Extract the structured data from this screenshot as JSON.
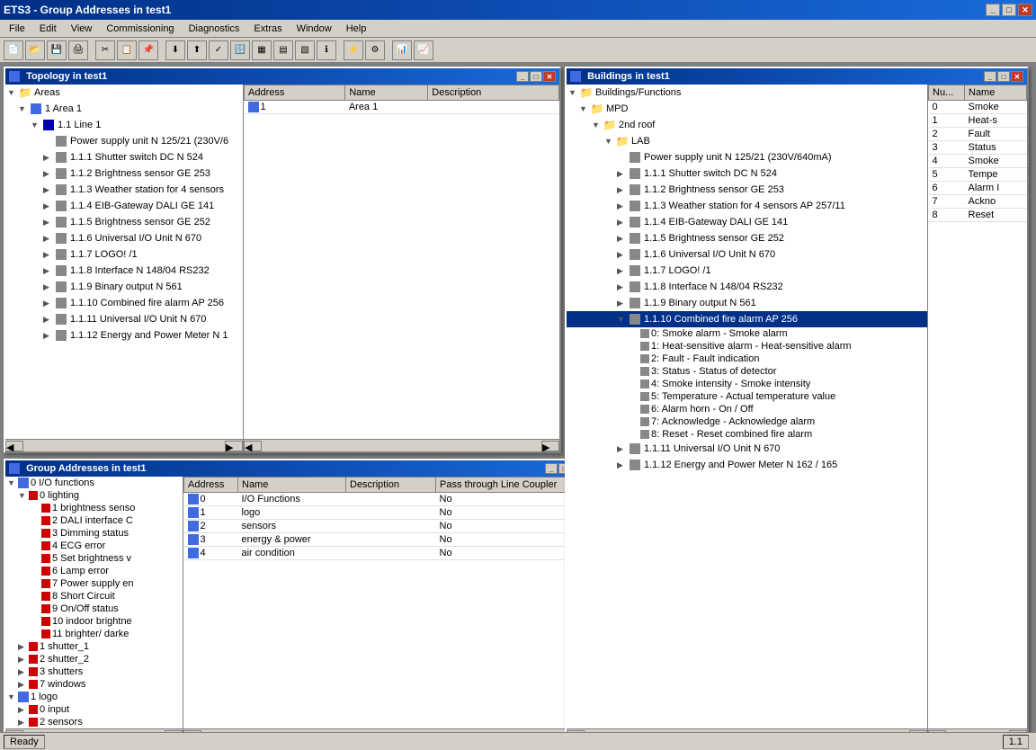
{
  "app": {
    "title": "ETS3 - Group Addresses in test1",
    "status": "Ready",
    "version": "1.1"
  },
  "menu": {
    "items": [
      "File",
      "Edit",
      "View",
      "Commissioning",
      "Diagnostics",
      "Extras",
      "Window",
      "Help"
    ]
  },
  "topology_window": {
    "title": "Topology in test1",
    "columns": [
      "Address",
      "Name",
      "Description"
    ],
    "area_row": {
      "address": "1",
      "name": "Area 1"
    },
    "tree": [
      {
        "label": "Areas",
        "level": 0,
        "expanded": true
      },
      {
        "label": "1 Area 1",
        "level": 1,
        "expanded": true
      },
      {
        "label": "1.1 Line 1",
        "level": 2,
        "expanded": true
      },
      {
        "label": "Power supply unit N 125/21 (230V/6",
        "level": 3
      },
      {
        "label": "1.1.1 Shutter switch DC N 524",
        "level": 3
      },
      {
        "label": "1.1.2 Brightness sensor GE 253",
        "level": 3
      },
      {
        "label": "1.1.3 Weather station for 4 sensors",
        "level": 3
      },
      {
        "label": "1.1.4 EIB-Gateway DALI GE 141",
        "level": 3
      },
      {
        "label": "1.1.5 Brightness sensor GE 252",
        "level": 3
      },
      {
        "label": "1.1.6 Universal I/O Unit N 670",
        "level": 3
      },
      {
        "label": "1.1.7 LOGO!  /1",
        "level": 3
      },
      {
        "label": "1.1.8 Interface N 148/04 RS232",
        "level": 3
      },
      {
        "label": "1.1.9 Binary output N 561",
        "level": 3
      },
      {
        "label": "1.1.10 Combined fire alarm AP 256",
        "level": 3
      },
      {
        "label": "1.1.11 Universal I/O Unit N 670",
        "level": 3
      },
      {
        "label": "1.1.12 Energy and Power Meter N 1",
        "level": 3
      }
    ]
  },
  "group_addresses_window": {
    "title": "Group Addresses in test1",
    "columns": [
      "Address",
      "Name",
      "Description",
      "Pass through Line Coupler"
    ],
    "tree": [
      {
        "label": "0 I/O functions",
        "level": 0,
        "expanded": true
      },
      {
        "label": "0 lighting",
        "level": 1,
        "expanded": true
      },
      {
        "label": "1 brightness senso",
        "level": 2
      },
      {
        "label": "2 DALI interface C",
        "level": 2
      },
      {
        "label": "3 Dimming status",
        "level": 2
      },
      {
        "label": "4 ECG error",
        "level": 2
      },
      {
        "label": "5 Set brightness v",
        "level": 2
      },
      {
        "label": "6 Lamp error",
        "level": 2
      },
      {
        "label": "7 Power supply en",
        "level": 2
      },
      {
        "label": "8 Short Circuit",
        "level": 2
      },
      {
        "label": "9 On/Off status",
        "level": 2
      },
      {
        "label": "10 indoor brightne",
        "level": 2
      },
      {
        "label": "11 brighter/ darke",
        "level": 2
      },
      {
        "label": "1 shutter_1",
        "level": 1
      },
      {
        "label": "2 shutter_2",
        "level": 1
      },
      {
        "label": "3 shutters",
        "level": 1
      },
      {
        "label": "7 windows",
        "level": 1
      },
      {
        "label": "1 logo",
        "level": 0,
        "expanded": true
      },
      {
        "label": "0 input",
        "level": 1
      },
      {
        "label": "2 sensors",
        "level": 1
      }
    ],
    "table_rows": [
      {
        "address": "0",
        "name": "I/O Functions",
        "description": "",
        "pass": "No"
      },
      {
        "address": "1",
        "name": "logo",
        "description": "",
        "pass": "No"
      },
      {
        "address": "2",
        "name": "sensors",
        "description": "",
        "pass": "No"
      },
      {
        "address": "3",
        "name": "energy & power",
        "description": "",
        "pass": "No"
      },
      {
        "address": "4",
        "name": "air condition",
        "description": "",
        "pass": "No"
      }
    ]
  },
  "buildings_window": {
    "title": "Buildings in test1",
    "columns": [
      "Nu...",
      "Name"
    ],
    "right_col_rows": [
      {
        "num": "0",
        "name": "Smoke"
      },
      {
        "num": "1",
        "name": "Heat-s"
      },
      {
        "num": "2",
        "name": "Fault"
      },
      {
        "num": "3",
        "name": "Status"
      },
      {
        "num": "4",
        "name": "Smoke"
      },
      {
        "num": "5",
        "name": "Tempe"
      },
      {
        "num": "6",
        "name": "Alarm I"
      },
      {
        "num": "7",
        "name": "Ackno"
      },
      {
        "num": "8",
        "name": "Reset"
      }
    ],
    "tree": [
      {
        "label": "Buildings/Functions",
        "level": 0,
        "expanded": true
      },
      {
        "label": "MPD",
        "level": 1,
        "expanded": true
      },
      {
        "label": "2nd roof",
        "level": 2,
        "expanded": true
      },
      {
        "label": "LAB",
        "level": 3,
        "expanded": true
      },
      {
        "label": "Power supply unit N 125/21 (230V/640mA)",
        "level": 4
      },
      {
        "label": "1.1.1 Shutter switch DC N 524",
        "level": 4
      },
      {
        "label": "1.1.2 Brightness sensor GE 253",
        "level": 4
      },
      {
        "label": "1.1.3 Weather station for 4 sensors  AP 257/11",
        "level": 4
      },
      {
        "label": "1.1.4 EIB-Gateway DALI GE 141",
        "level": 4
      },
      {
        "label": "1.1.5 Brightness sensor GE 252",
        "level": 4
      },
      {
        "label": "1.1.6 Universal I/O Unit N 670",
        "level": 4
      },
      {
        "label": "1.1.7 LOGO!  /1",
        "level": 4
      },
      {
        "label": "1.1.8 Interface N 148/04 RS232",
        "level": 4
      },
      {
        "label": "1.1.9 Binary output N 561",
        "level": 4
      },
      {
        "label": "1.1.10 Combined fire alarm AP 256",
        "level": 4,
        "expanded": true
      },
      {
        "label": "0: Smoke alarm - Smoke alarm",
        "level": 5
      },
      {
        "label": "1: Heat-sensitive alarm - Heat-sensitive alarm",
        "level": 5
      },
      {
        "label": "2: Fault - Fault indication",
        "level": 5
      },
      {
        "label": "3: Status - Status of detector",
        "level": 5
      },
      {
        "label": "4: Smoke intensity - Smoke intensity",
        "level": 5
      },
      {
        "label": "5: Temperature - Actual temperature value",
        "level": 5
      },
      {
        "label": "6: Alarm horn - On / Off",
        "level": 5
      },
      {
        "label": "7: Acknowledge - Acknowledge alarm",
        "level": 5
      },
      {
        "label": "8: Reset - Reset combined fire alarm",
        "level": 5
      },
      {
        "label": "1.1.11 Universal I/O Unit N 670",
        "level": 4
      },
      {
        "label": "1.1.12 Energy and Power Meter N 162 / 165",
        "level": 4
      }
    ]
  }
}
